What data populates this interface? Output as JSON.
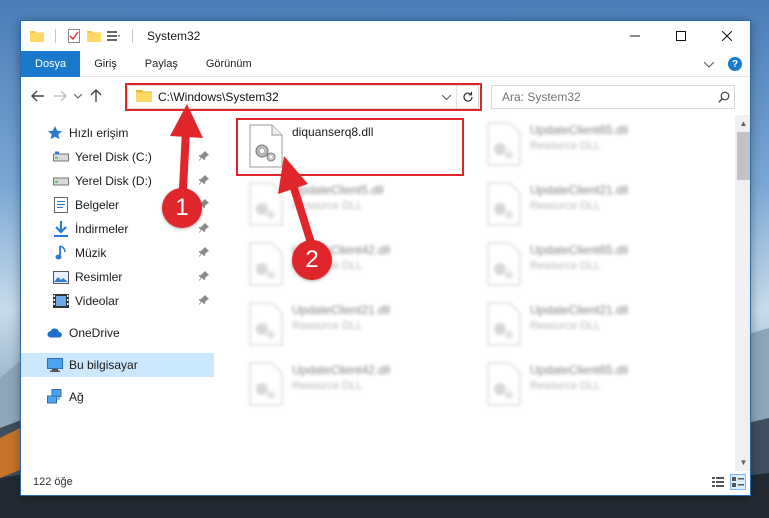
{
  "window": {
    "title": "System32"
  },
  "ribbon": {
    "tabs": [
      {
        "label": "Dosya",
        "active": true
      },
      {
        "label": "Giriş"
      },
      {
        "label": "Paylaş"
      },
      {
        "label": "Görünüm"
      }
    ]
  },
  "address": {
    "path": "C:\\Windows\\System32"
  },
  "search": {
    "placeholder": "Ara: System32"
  },
  "nav": {
    "quick_access": "Hızlı erişim",
    "items": [
      {
        "label": "Yerel Disk (C:)",
        "icon": "drive-icon"
      },
      {
        "label": "Yerel Disk (D:)",
        "icon": "drive-icon"
      },
      {
        "label": "Belgeler",
        "icon": "documents-icon"
      },
      {
        "label": "İndirmeler",
        "icon": "downloads-icon"
      },
      {
        "label": "Müzik",
        "icon": "music-icon"
      },
      {
        "label": "Resimler",
        "icon": "pictures-icon"
      },
      {
        "label": "Videolar",
        "icon": "videos-icon"
      }
    ],
    "onedrive": "OneDrive",
    "this_pc": "Bu bilgisayar",
    "network": "Ağ"
  },
  "files": {
    "highlighted": {
      "name": "diquanserq8.dll"
    },
    "col2": [
      {
        "name": "UpdateClient65.dll",
        "type": "Resource DLL"
      },
      {
        "name": "UpdateClient21.dll",
        "type": "Resource DLL"
      },
      {
        "name": "UpdateClient65.dll",
        "type": "Resource DLL"
      },
      {
        "name": "UpdateClient21.dll",
        "type": "Resource DLL"
      },
      {
        "name": "UpdateClient65.dll",
        "type": "Resource DLL"
      }
    ],
    "col1": [
      {
        "name": "UpdateClient5.dll",
        "type": "Resource DLL"
      },
      {
        "name": "UpdateClient42.dll",
        "type": "Resource DLL"
      },
      {
        "name": "UpdateClient21.dll",
        "type": "Resource DLL"
      },
      {
        "name": "UpdateClient42.dll",
        "type": "Resource DLL"
      }
    ]
  },
  "status": {
    "count": "122 öğe"
  },
  "callouts": {
    "one": "1",
    "two": "2"
  },
  "colors": {
    "accent": "#1979ca",
    "highlight": "#e0262b",
    "selected": "#cce8ff"
  }
}
